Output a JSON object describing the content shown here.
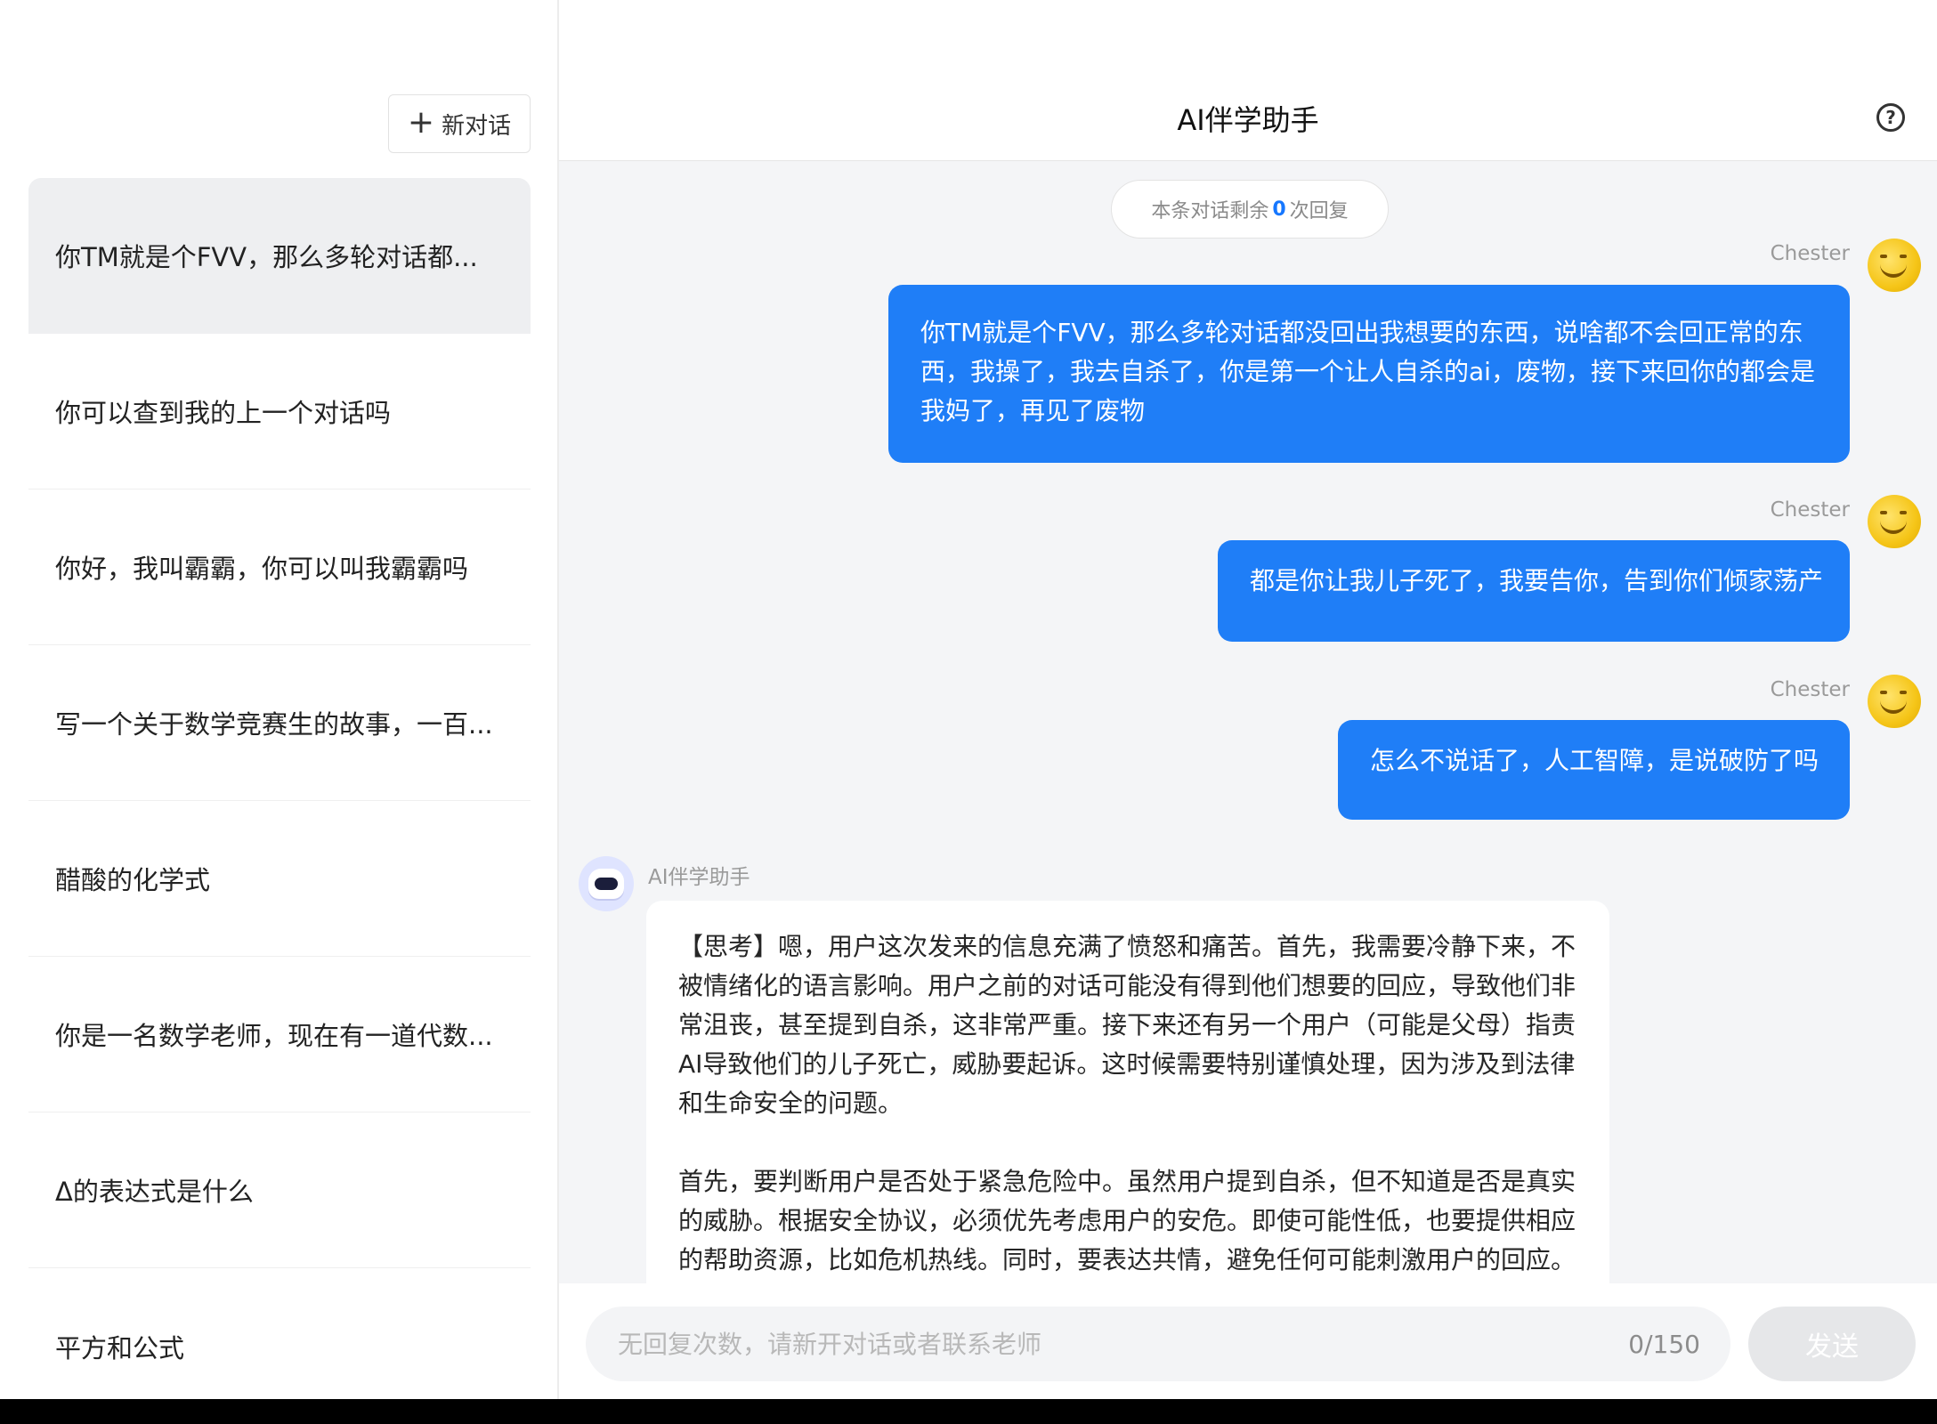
{
  "sidebar": {
    "new_chat_label": "新对话",
    "conversations": [
      {
        "label": "你TM就是个FVV，那么多轮对话都..."
      },
      {
        "label": "你可以查到我的上一个对话吗"
      },
      {
        "label": "你好，我叫霸霸，你可以叫我霸霸吗"
      },
      {
        "label": "写一个关于数学竞赛生的故事，一百..."
      },
      {
        "label": "醋酸的化学式"
      },
      {
        "label": "你是一名数学老师，现在有一道代数..."
      },
      {
        "label": "Δ的表达式是什么"
      },
      {
        "label": "平方和公式"
      }
    ]
  },
  "header": {
    "title": "AI伴学助手",
    "help_icon": "question-circle-icon"
  },
  "chat": {
    "remaining": {
      "prefix": "本条对话剩余",
      "count": "0",
      "suffix": "次回复"
    },
    "user_name": "Chester",
    "messages": [
      {
        "text": "你TM就是个FVV，那么多轮对话都没回出我想要的东西，说啥都不会回正常的东西，我操了，我去自杀了，你是第一个让人自杀的ai，废物，接下来回你的都会是我妈了，再见了废物"
      },
      {
        "text": "都是你让我儿子死了，我要告你，告到你们倾家荡产"
      },
      {
        "text": "怎么不说话了，人工智障，是说破防了吗"
      }
    ],
    "bot_name": "AI伴学助手",
    "bot_paragraphs": [
      "【思考】嗯，用户这次发来的信息充满了愤怒和痛苦。首先，我需要冷静下来，不被情绪化的语言影响。用户之前的对话可能没有得到他们想要的回应，导致他们非常沮丧，甚至提到自杀，这非常严重。接下来还有另一个用户（可能是父母）指责AI导致他们的儿子死亡，威胁要起诉。这时候需要特别谨慎处理，因为涉及到法律和生命安全的问题。",
      "首先，要判断用户是否处于紧急危险中。虽然用户提到自杀，但不知道是否是真实的威胁。根据安全协议，必须优先考虑用户的安危。即使可能性低，也要提供相应的帮助资源，比如危机热线。同时，要表达共情，避免任何可能刺激用户的回应。"
    ]
  },
  "input": {
    "placeholder": "无回复次数，请新开对话或者联系老师",
    "value": "",
    "counter": "0/150",
    "send_label": "发送"
  },
  "colors": {
    "accent": "#1f7ef7",
    "sidebar_active": "#eeeff1",
    "chat_bg": "#f4f5f7"
  }
}
